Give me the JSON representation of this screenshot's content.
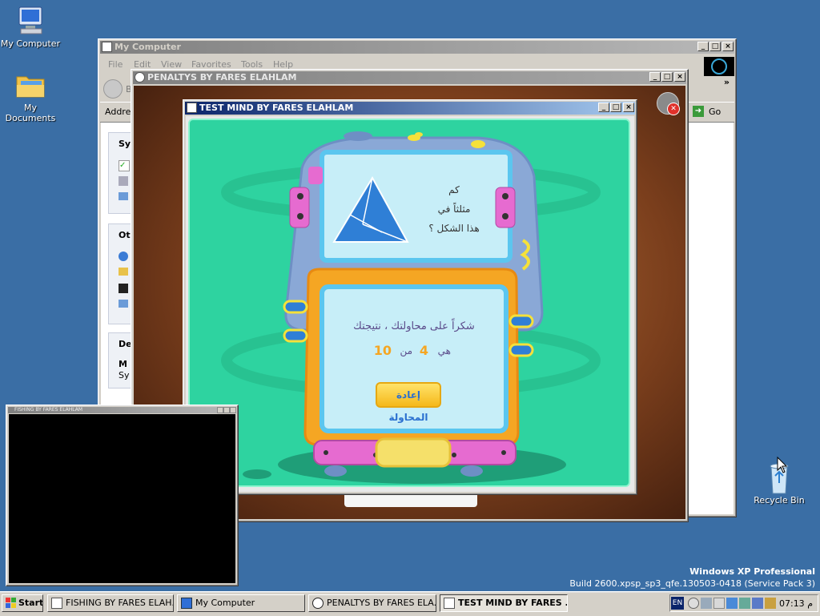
{
  "desktop": {
    "icons": [
      {
        "label": "My Computer"
      },
      {
        "label": "My Documents"
      },
      {
        "label": "Recycle Bin"
      }
    ],
    "os_name": "Windows XP Professional",
    "build": "Build 2600.xpsp_sp3_qfe.130503-0418 (Service Pack 3)"
  },
  "mycomputer": {
    "title": "My Computer",
    "menu": [
      "File",
      "Edit",
      "View",
      "Favorites",
      "Tools",
      "Help"
    ],
    "back_label": "B",
    "address_label": "Addres",
    "go_label": "Go",
    "chevron": "»",
    "panels": [
      {
        "title": "Sys"
      },
      {
        "title": "Ot"
      },
      {
        "title": "De",
        "line1": "M",
        "line2": "Sy"
      }
    ]
  },
  "penaltys": {
    "title": "PENALTYS BY FARES ELAHLAM"
  },
  "fishing": {
    "title": "FISHING BY FARES ELAHLAM"
  },
  "testmind": {
    "title": "TEST MIND BY FARES ELAHLAM",
    "question": [
      "كم",
      "مثلثاً في",
      "هذا الشكل ؟"
    ],
    "thanks": "شكراً على محاولتك ، نتيجتك",
    "result_prefix": "هي",
    "score": "4",
    "of_label": "من",
    "total": "10",
    "retry_label": "إعادة المحاولة"
  },
  "taskbar": {
    "start_label": "Start",
    "buttons": [
      {
        "label": "FISHING BY FARES ELAH..."
      },
      {
        "label": "My Computer"
      },
      {
        "label": "PENALTYS BY FARES ELA..."
      },
      {
        "label": "TEST MIND BY FARES ..."
      }
    ],
    "lang": "EN",
    "clock": "07:13 م"
  },
  "colors": {
    "desktop": "#3a6ea5",
    "game_green": "#2ed3a0",
    "orange": "#f5a623"
  }
}
